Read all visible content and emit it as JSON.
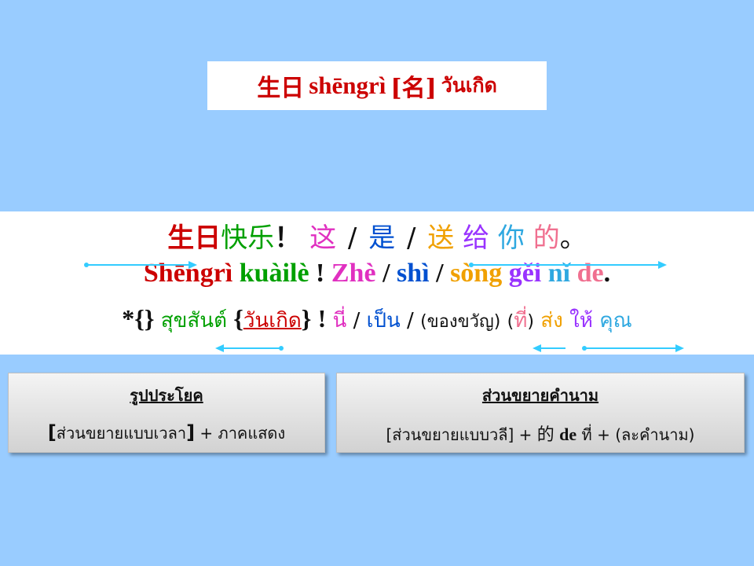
{
  "title": {
    "hanzi": "生日",
    "pinyin": "shēngrì",
    "pos": "[名]",
    "thai": "วันเกิด"
  },
  "sentence": {
    "hanzi": {
      "shengri": "生日",
      "kuaile": "快乐",
      "excl": "！",
      "zhe": "这",
      "slash": "/",
      "shi": "是",
      "song": "送",
      "gei": "给",
      "ni": "你",
      "de": "的",
      "period": "。"
    },
    "pinyin": {
      "shengri": "Shēngrì",
      "kuaile": "kuàilè",
      "excl": "!",
      "zhe": "Zhè",
      "slash": "/",
      "shi": "shì",
      "song": "sòng",
      "gei": "gěi",
      "ni": "nǐ",
      "de": "de",
      "period": "."
    },
    "thai": {
      "prefix": "*{}",
      "sukhasan": "สุขสันต์",
      "brace_open": "{",
      "wankoet": "วันเกิด",
      "brace_close": "}",
      "excl": "!",
      "ni": "นี่",
      "slash": "/",
      "pen": "เป็น",
      "khongkhwan": "(ของขวัญ)",
      "open_paren": "(",
      "thi": "ที่",
      "close_paren": ")",
      "song": "ส่ง",
      "hai": "ให้",
      "khun": "คุณ"
    }
  },
  "boxes": {
    "left": {
      "heading": "รูปประโยค",
      "formula_bracket_open": "[",
      "formula_main": "ส่วนขยายแบบเวลา",
      "formula_bracket_close": "]",
      "formula_rest": "+ ภาคแสดง"
    },
    "right": {
      "heading": "ส่วนขยายคำนาม",
      "formula_part1": "[ส่วนขยายแบบวลี] +",
      "formula_de_hanzi": "的",
      "formula_de_pinyin": "de",
      "formula_part2": "ที่ + (ละคำนาม)"
    }
  },
  "colors": {
    "red": "#cc0000",
    "green": "#00a000",
    "magenta": "#e030c0",
    "blue": "#0050d0",
    "orange": "#f0a000",
    "purple": "#9933ff",
    "sky": "#2fa8e0",
    "pink": "#f07090",
    "arrow": "#33ccff"
  }
}
